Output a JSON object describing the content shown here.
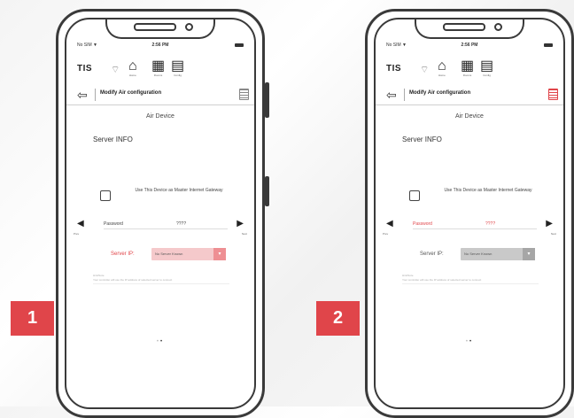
{
  "screens": [
    {
      "step": "1",
      "status": {
        "carrier": "No SIM ▼",
        "time": "2:56 PM"
      },
      "toolbar": {
        "logo": "TIS",
        "home_caption": "Home",
        "rooms_caption": "Rooms",
        "config_caption": "Config"
      },
      "header": {
        "title": "Modify Air configuration"
      },
      "section_title": "Air Device",
      "server_info": "Server INFO",
      "gateway_label": "Use This Device as Master Internet Gateway",
      "prev_caption": "Prev",
      "next_caption": "Next",
      "password_label": "Password",
      "password_value": "????",
      "server_ip_label": "Server IP:",
      "server_ip_value": "No Server Known",
      "note": "Hint/Note",
      "note_detail": "Your controller will use the IP address of selected server to connect",
      "highlight": "server-ip"
    },
    {
      "step": "2",
      "status": {
        "carrier": "No SIM ▼",
        "time": "2:56 PM"
      },
      "toolbar": {
        "logo": "TIS",
        "home_caption": "Home",
        "rooms_caption": "Rooms",
        "config_caption": "Config"
      },
      "header": {
        "title": "Modify Air configuration"
      },
      "section_title": "Air Device",
      "server_info": "Server INFO",
      "gateway_label": "Use This Device as Master Internet Gateway",
      "prev_caption": "Prev",
      "next_caption": "Next",
      "password_label": "Password",
      "password_value": "????",
      "server_ip_label": "Server IP:",
      "server_ip_value": "No Server Known",
      "note": "Hint/Note",
      "note_detail": "Your controller will use the IP address of selected server to connect",
      "highlight": "password"
    }
  ],
  "colors": {
    "accent": "#e0454a",
    "frame": "#3a3a3a"
  }
}
